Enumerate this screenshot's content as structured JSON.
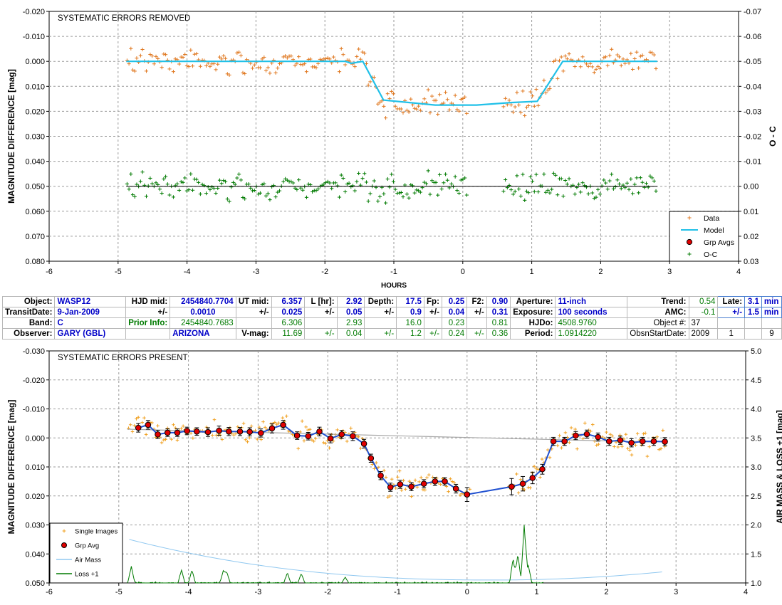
{
  "chart_data": [
    {
      "type": "scatter",
      "title": "SYSTEMATIC ERRORS REMOVED",
      "xlabel": "HOURS",
      "ylabel": "MAGNITUDE DIFFERENCE [mag]",
      "y2label": "O - C",
      "xlim": [
        -6,
        4
      ],
      "ylim": [
        -0.02,
        0.08
      ],
      "y_inverted": true,
      "y2lim": [
        -0.07,
        0.03
      ],
      "y2_inverted": true,
      "x_ticks": [
        "-6",
        "-5",
        "-4",
        "-3",
        "-2",
        "-1",
        "0",
        "1",
        "2",
        "3",
        "4"
      ],
      "y_ticks": [
        "-0.020",
        "-0.010",
        "0.000",
        "0.010",
        "0.020",
        "0.030",
        "0.040",
        "0.050",
        "0.060",
        "0.070",
        "0.080"
      ],
      "y2_ticks": [
        "-0.07",
        "-0.06",
        "-0.05",
        "-0.04",
        "-0.03",
        "-0.02",
        "-0.01",
        "0.00",
        "0.01",
        "0.02",
        "0.03"
      ],
      "grid": true,
      "legend_position": "bottom-right",
      "series": [
        {
          "name": "Data",
          "color": "#e07820",
          "marker": "plus"
        },
        {
          "name": "Model",
          "color": "#20c0e8",
          "marker": "line",
          "x": [
            -4.88,
            -1.7,
            -1.62,
            -1.45,
            -1.15,
            -0.4,
            0.2,
            0.7,
            1.08,
            1.45,
            2.82
          ],
          "y": [
            0.0,
            0.0,
            0.0008,
            0.0,
            0.0155,
            0.0175,
            0.0175,
            0.0165,
            0.016,
            0.0,
            0.0
          ]
        },
        {
          "name": "Grp Avgs",
          "color": "#e00000",
          "marker": "circle"
        },
        {
          "name": "O-C",
          "color": "#007a00",
          "marker": "plus"
        }
      ],
      "oc_reference_level": 0.0
    },
    {
      "type": "scatter",
      "title": "SYSTEMATIC ERRORS PRESENT",
      "xlabel": "",
      "ylabel": "MAGNITUDE DIFFERENCE [mag]",
      "y2label": "AIR MASS & LOSS +1 [mag]",
      "xlim": [
        -6,
        4
      ],
      "ylim": [
        -0.03,
        0.05
      ],
      "y_inverted": true,
      "y2lim": [
        1.0,
        5.0
      ],
      "x_ticks": [
        "-6",
        "-5",
        "-4",
        "-3",
        "-2",
        "-1",
        "0",
        "1",
        "2",
        "3",
        "4"
      ],
      "y_ticks": [
        "-0.030",
        "-0.020",
        "-0.010",
        "0.000",
        "0.010",
        "0.020",
        "0.030",
        "0.040",
        "0.050"
      ],
      "y2_ticks": [
        "5.0",
        "4.5",
        "4.0",
        "3.5",
        "3.0",
        "2.5",
        "2.0",
        "1.5",
        "1.0"
      ],
      "grid": true,
      "legend_position": "bottom-left",
      "series": [
        {
          "name": "Single Images",
          "color": "#f0a020",
          "marker": "plus"
        },
        {
          "name": "Grp Avg",
          "color": "#e00000",
          "marker": "circle",
          "x": [
            -4.72,
            -4.58,
            -4.44,
            -4.3,
            -4.16,
            -4.02,
            -3.88,
            -3.72,
            -3.56,
            -3.42,
            -3.26,
            -3.12,
            -2.96,
            -2.8,
            -2.64,
            -2.44,
            -2.28,
            -2.12,
            -1.96,
            -1.8,
            -1.64,
            -1.48,
            -1.38,
            -1.24,
            -1.1,
            -0.96,
            -0.8,
            -0.62,
            -0.46,
            -0.32,
            -0.16,
            0.0,
            0.64,
            0.8,
            0.94,
            1.08,
            1.24,
            1.4,
            1.56,
            1.72,
            1.88,
            2.04,
            2.2,
            2.36,
            2.52,
            2.68,
            2.84
          ],
          "y": [
            -0.0035,
            -0.0045,
            -0.0012,
            -0.0018,
            -0.0018,
            -0.0024,
            -0.0022,
            -0.002,
            -0.0025,
            -0.0022,
            -0.0022,
            -0.0021,
            -0.0017,
            -0.0033,
            -0.0045,
            -0.0008,
            -0.0006,
            -0.0022,
            0.0002,
            -0.0012,
            -0.0006,
            0.002,
            0.007,
            0.013,
            0.017,
            0.016,
            0.0168,
            0.0158,
            0.015,
            0.015,
            0.0175,
            0.0195,
            0.0168,
            0.0158,
            0.0138,
            0.0108,
            0.0012,
            0.0012,
            -0.0008,
            -0.0013,
            -0.0003,
            0.0012,
            0.0008,
            0.0017,
            0.0012,
            0.0012,
            0.0013
          ],
          "err": [
            0.0015,
            0.0015,
            0.0014,
            0.0013,
            0.0013,
            0.0013,
            0.0013,
            0.0015,
            0.0016,
            0.0014,
            0.0014,
            0.0014,
            0.0014,
            0.0016,
            0.0015,
            0.0013,
            0.0013,
            0.0015,
            0.0015,
            0.0014,
            0.0015,
            0.0015,
            0.0014,
            0.0014,
            0.0014,
            0.0014,
            0.0014,
            0.0014,
            0.0014,
            0.0013,
            0.0015,
            0.0024,
            0.0028,
            0.0025,
            0.002,
            0.0017,
            0.0014,
            0.0014,
            0.0014,
            0.0014,
            0.0014,
            0.0014,
            0.0014,
            0.0014,
            0.0014,
            0.0014,
            0.0014
          ]
        },
        {
          "name": "Air Mass",
          "color": "#90c8f0",
          "marker": "line"
        },
        {
          "name": "Loss +1",
          "color": "#007a00",
          "marker": "line"
        }
      ]
    }
  ],
  "info_table": {
    "r1": {
      "object_lbl": "Object:",
      "object": "WASP12",
      "hjd_lbl": "HJD mid:",
      "hjd": "2454840.7704",
      "ut_lbl": "UT mid:",
      "ut": "6.357",
      "l_lbl": "L [hr]:",
      "l": "2.92",
      "depth_lbl": "Depth:",
      "depth": "17.5",
      "fp_lbl": "Fp:",
      "fp": "0.25",
      "f2_lbl": "F2:",
      "f2": "0.90",
      "ap_lbl": "Aperture:",
      "ap": "11-inch",
      "trend_lbl": "Trend:",
      "trend": "0.54",
      "late_lbl": "Late:",
      "late": "3.1",
      "late_unit": "min"
    },
    "r2": {
      "td_lbl": "TransitDate:",
      "td": "9-Jan-2009",
      "pm1": "+/-",
      "hjd_err": "0.0010",
      "pm2": "+/-",
      "ut_err": "0.025",
      "pm3": "+/-",
      "l_err": "0.05",
      "pm4": "+/-",
      "depth_err": "0.9",
      "pm5": "+/-",
      "fp_err": "0.04",
      "pm6": "+/-",
      "f2_err": "0.31",
      "exp_lbl": "Exposure:",
      "exp": "100 seconds",
      "amc_lbl": "AMC:",
      "amc": "-0.1",
      "pm7": "+/-",
      "late_err": "1.5",
      "late_unit": "min"
    },
    "r3": {
      "band_lbl": "Band:",
      "band": "C",
      "prior_lbl": "Prior Info:",
      "prior_hjd": "2454840.7683",
      "prior_ut": "6.306",
      "prior_l": "2.93",
      "prior_depth": "16.0",
      "prior_fp": "0.23",
      "prior_f2": "0.81",
      "hjdo_lbl": "HJDo:",
      "hjdo": "4508.9760",
      "objn_lbl": "Object #:",
      "objn": "37"
    },
    "r4": {
      "obs_lbl": "Observer:",
      "obs": "GARY (GBL)",
      "loc": "ARIZONA",
      "vmag_lbl": "V-mag:",
      "vmag": "11.69",
      "pm1": "+/-",
      "vmag_err": "0.04",
      "pm2": "+/-",
      "depth_err2": "1.2",
      "pm3": "+/-",
      "fp_err2": "0.24",
      "pm4": "+/-",
      "f2_err2": "0.36",
      "per_lbl": "Period:",
      "per": "1.0914220",
      "osd_lbl": "ObsnStartDate:",
      "osd_y": "2009",
      "osd_m": "1",
      "osd_d": "9"
    }
  }
}
